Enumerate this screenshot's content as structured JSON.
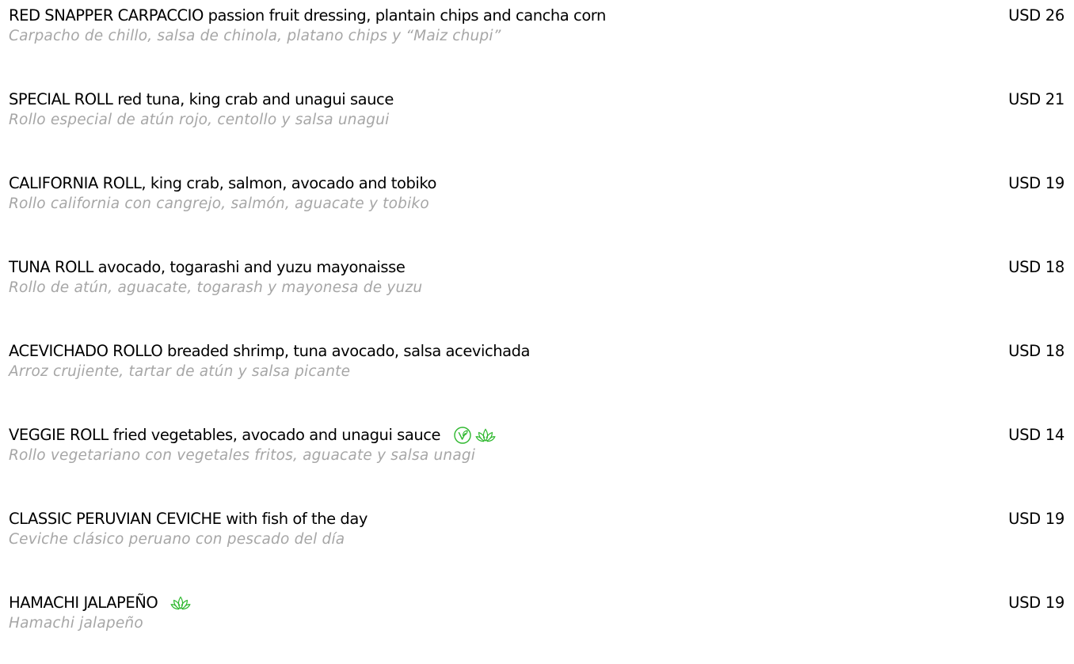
{
  "colors": {
    "text": "#000000",
    "description": "#a6a6a6",
    "diet_icon": "#2eb82e"
  },
  "items": [
    {
      "name": "RED SNAPPER CARPACCIO passion fruit dressing, plantain chips and cancha corn",
      "description": "Carpacho de chillo, salsa de chinola, platano chips y “Maiz chupi”",
      "price": "USD 26",
      "icons": []
    },
    {
      "name": "SPECIAL ROLL red tuna, king crab and unagui sauce",
      "description": "Rollo especial de atún rojo, centollo y salsa unagui",
      "price": "USD 21",
      "icons": []
    },
    {
      "name": "CALIFORNIA ROLL, king crab, salmon, avocado and tobiko",
      "description": "Rollo california con cangrejo, salmón, aguacate y tobiko",
      "price": "USD 19",
      "icons": []
    },
    {
      "name": "TUNA ROLL avocado, togarashi and yuzu mayonaisse",
      "description": "Rollo de atún, aguacate, togarash y mayonesa de yuzu",
      "price": "USD 18",
      "icons": []
    },
    {
      "name": "ACEVICHADO ROLLO breaded shrimp, tuna avocado, salsa acevichada",
      "description": "Arroz crujiente, tartar de atún y salsa picante",
      "price": "USD 18",
      "icons": []
    },
    {
      "name": "VEGGIE ROLL fried vegetables, avocado and unagui sauce",
      "description": "Rollo vegetariano con vegetales fritos, aguacate y salsa unagi",
      "price": "USD 14",
      "icons": [
        "vegetarian-icon",
        "lotus-icon"
      ]
    },
    {
      "name": "CLASSIC PERUVIAN CEVICHE with fish of the day",
      "description": "Ceviche clásico peruano con pescado del día",
      "price": "USD 19",
      "icons": []
    },
    {
      "name": "HAMACHI JALAPEÑO",
      "description": "Hamachi jalapeño",
      "price": "USD 19",
      "icons": [
        "lotus-icon"
      ]
    }
  ]
}
